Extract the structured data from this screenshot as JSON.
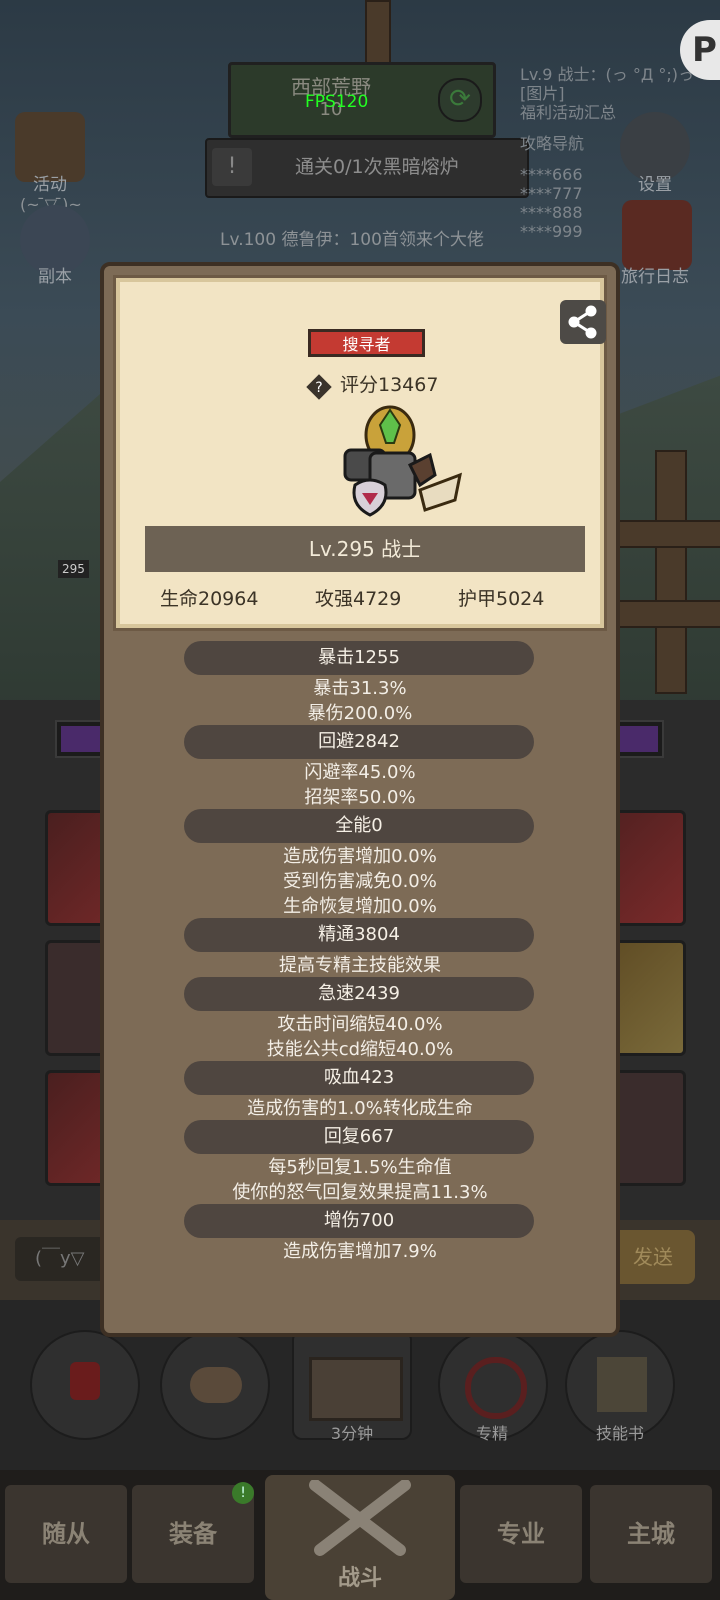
{
  "hud": {
    "zone_name": "西部荒野",
    "zone_sub": "10",
    "fps": "FPS120",
    "quest": "通关0/1次黑暗熔炉",
    "level_chat": "Lv.100 德鲁伊：100首领来个大佬",
    "chat_lines": [
      "Lv.9 战士：(っ °Д °;)っ",
      "[图片]",
      "福利活动汇总",
      "攻略导航",
      "****666",
      "****777",
      "****888",
      "****999"
    ],
    "left_icons": [
      {
        "label": "活动",
        "icon": "scroll-icon"
      },
      {
        "label": "副本",
        "icon": "portal-icon"
      }
    ],
    "right_icons": [
      {
        "label": "设置",
        "icon": "gear-icon"
      },
      {
        "label": "旅行日志",
        "icon": "book-icon"
      }
    ],
    "emote": "(~ ̄▽ ̄)~",
    "level_badge": "295"
  },
  "card": {
    "role": "搜寻者",
    "score": "评分13467",
    "level_class": "Lv.295 战士",
    "hp": "生命20964",
    "attack": "攻强4729",
    "armor": "护甲5024"
  },
  "stats": [
    {
      "title": "暴击1255",
      "details": [
        "暴击31.3%",
        "暴伤200.0%"
      ]
    },
    {
      "title": "回避2842",
      "details": [
        "闪避率45.0%",
        "招架率50.0%"
      ]
    },
    {
      "title": "全能0",
      "details": [
        "造成伤害增加0.0%",
        "受到伤害减免0.0%",
        "生命恢复增加0.0%"
      ]
    },
    {
      "title": "精通3804",
      "details": [
        "提高专精主技能效果"
      ]
    },
    {
      "title": "急速2439",
      "details": [
        "攻击时间缩短40.0%",
        "技能公共cd缩短40.0%"
      ]
    },
    {
      "title": "吸血423",
      "details": [
        "造成伤害的1.0%转化成生命"
      ]
    },
    {
      "title": "回复667",
      "details": [
        "每5秒回复1.5%生命值",
        "使你的怒气回复效果提高11.3%"
      ]
    },
    {
      "title": "增伤700",
      "details": [
        "造成伤害增加7.9%"
      ]
    }
  ],
  "chat": {
    "input_placeholder": "(￣y▽",
    "send": "发送"
  },
  "dock": [
    {
      "label": "",
      "icon": "potion-icon"
    },
    {
      "label": "",
      "icon": "bread-icon"
    },
    {
      "label": "3分钟",
      "icon": "chest-icon"
    },
    {
      "label": "专精",
      "icon": "specialization-icon"
    },
    {
      "label": "技能书",
      "icon": "skill-book-icon"
    }
  ],
  "nav": [
    "随从",
    "装备",
    "战斗",
    "专业",
    "主城"
  ],
  "colors": {
    "pill": "#4f4640",
    "panel": "#7d6b56",
    "card": "#f2e4c4",
    "badge": "#c43a32"
  }
}
